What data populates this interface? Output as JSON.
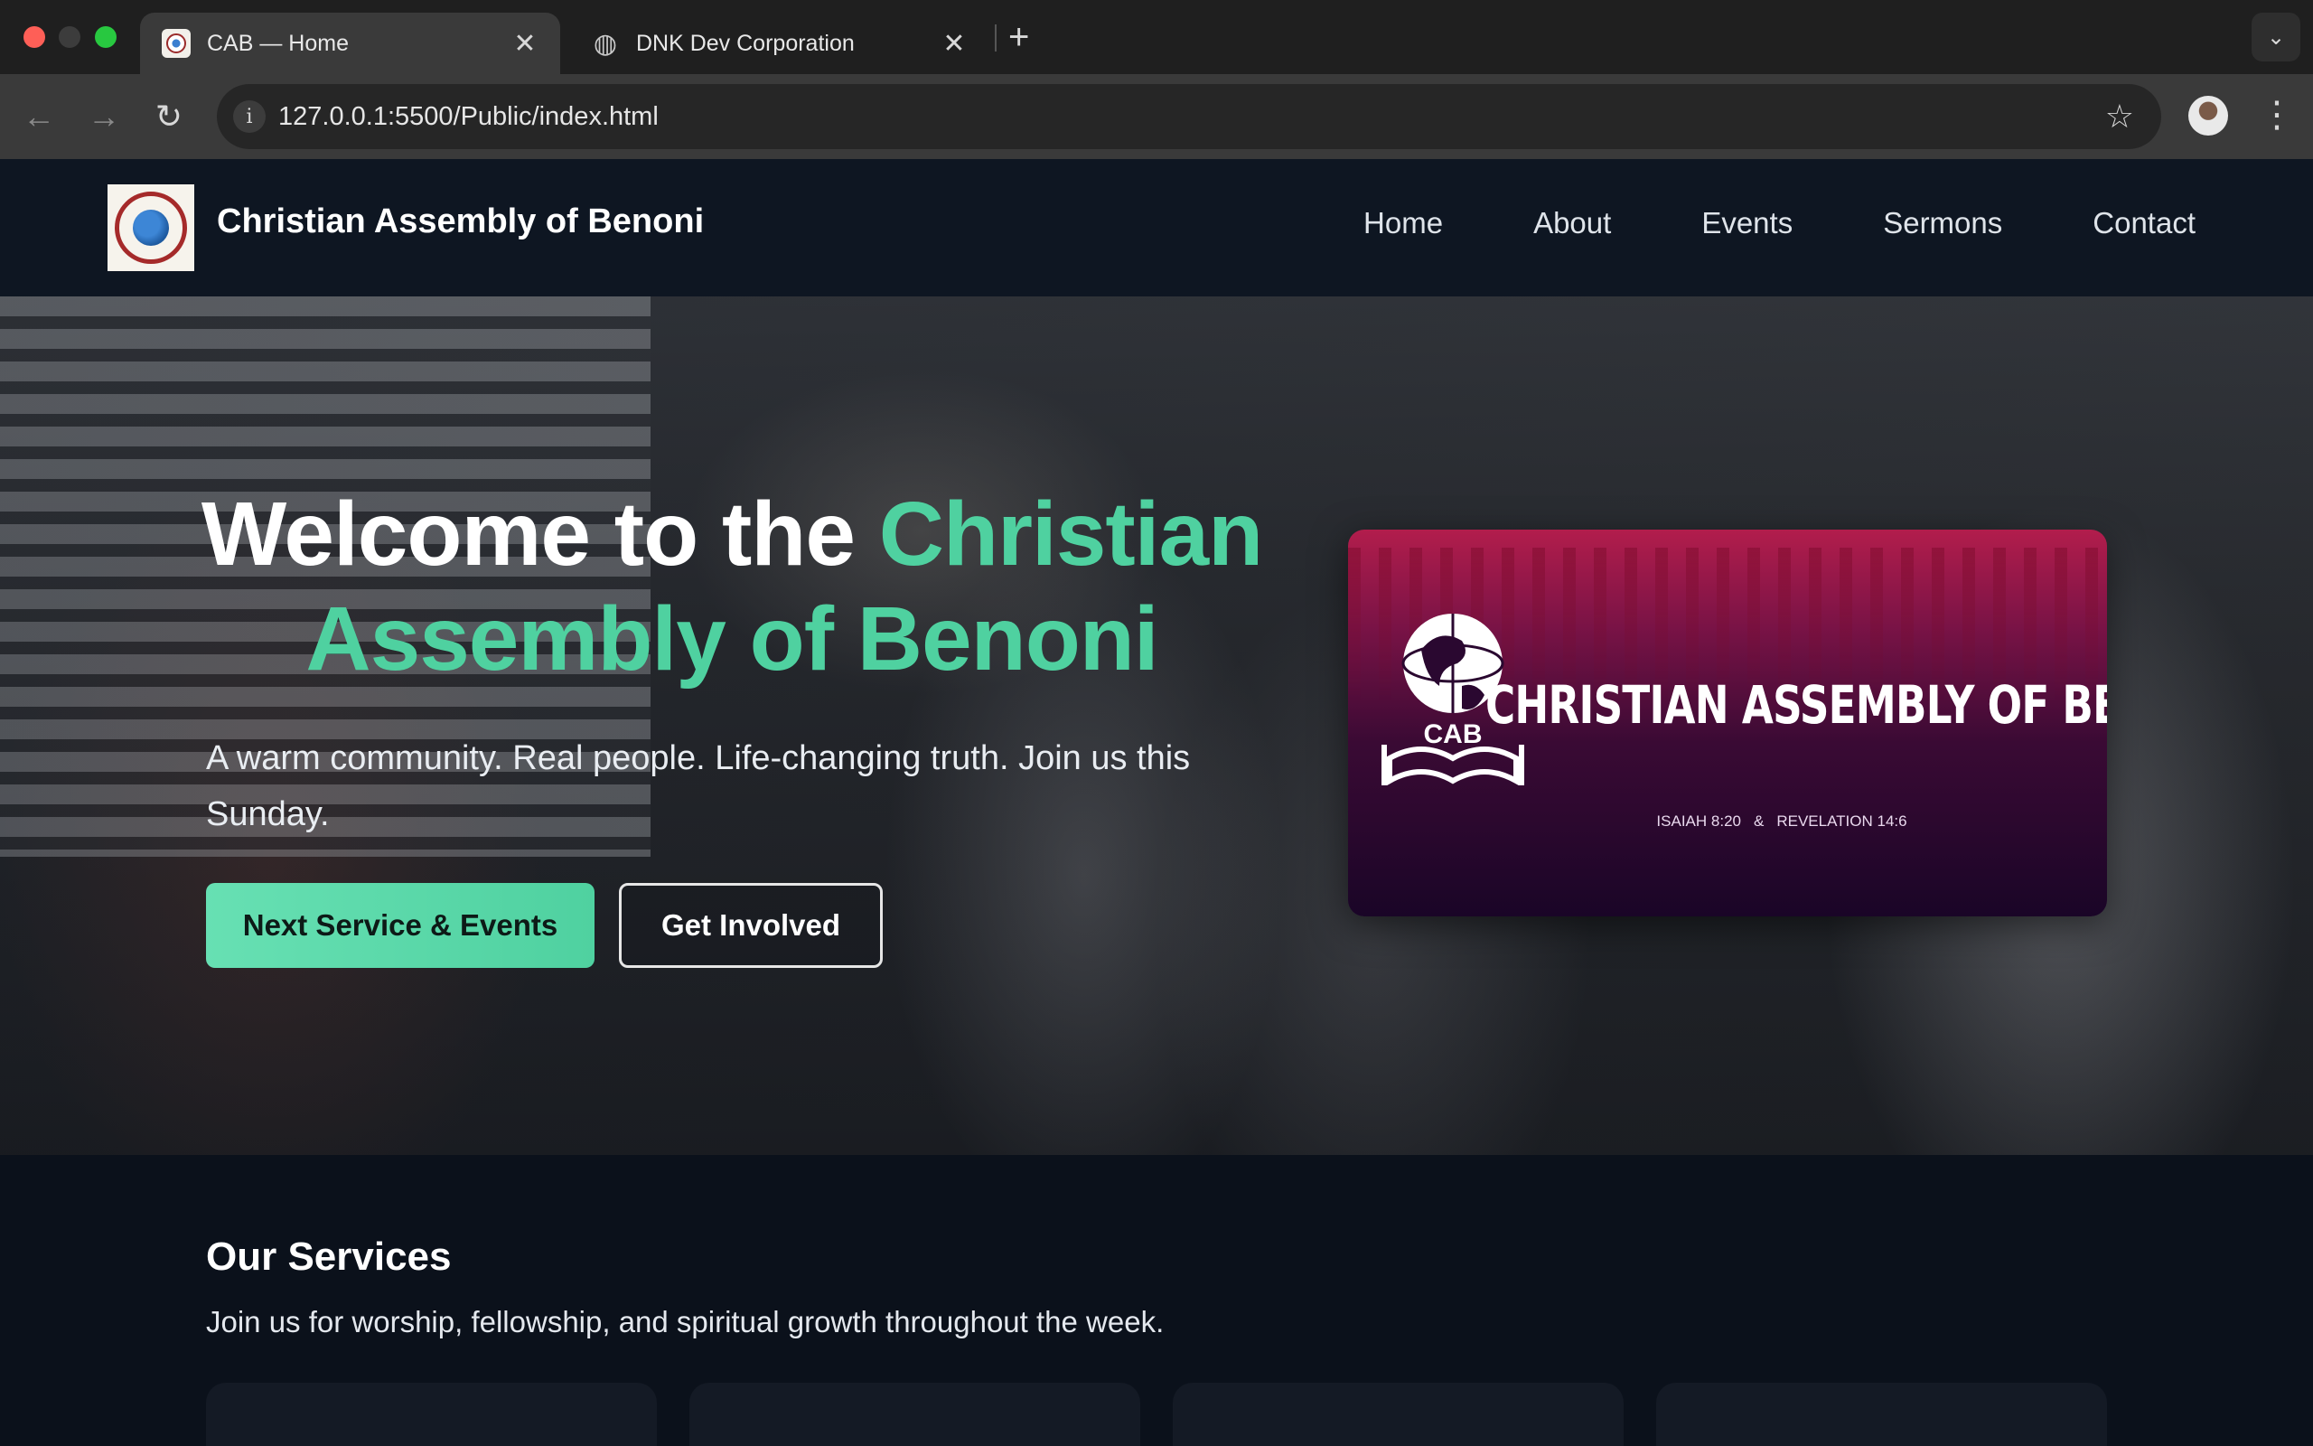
{
  "browser": {
    "tabs": [
      {
        "title": "CAB — Home",
        "active": true
      },
      {
        "title": "DNK Dev Corporation",
        "active": false
      }
    ],
    "url": "127.0.0.1:5500/Public/index.html",
    "icons": {
      "back": "arrow-left-icon",
      "forward": "arrow-right-icon",
      "reload": "reload-icon",
      "info": "info-icon",
      "bookmark": "star-icon",
      "menu": "kebab-icon"
    }
  },
  "site": {
    "brand": "Christian Assembly of Benoni",
    "nav": [
      "Home",
      "About",
      "Events",
      "Sermons",
      "Contact"
    ]
  },
  "hero": {
    "title_plain": "Welcome to the ",
    "title_accent": "Christian Assembly of Benoni",
    "subtitle": "A warm community. Real people. Life-changing truth. Join us this Sunday.",
    "primary_button": "Next Service & Events",
    "secondary_button": "Get Involved",
    "banner": {
      "emblem_text": "CAB",
      "title": "CHRISTIAN ASSEMBLY OF BENONI",
      "verse_left": "ISAIAH 8:20",
      "verse_sep": "&",
      "verse_right": "REVELATION 14:6"
    }
  },
  "services": {
    "title": "Our Services",
    "description": "Join us for worship, fellowship, and spiritual growth throughout the week."
  },
  "colors": {
    "accent": "#4fd1a0",
    "header_bg": "#0e1622",
    "page_bg": "#0b111b",
    "banner_top": "#b21d4c",
    "banner_bottom": "#1a0527"
  }
}
